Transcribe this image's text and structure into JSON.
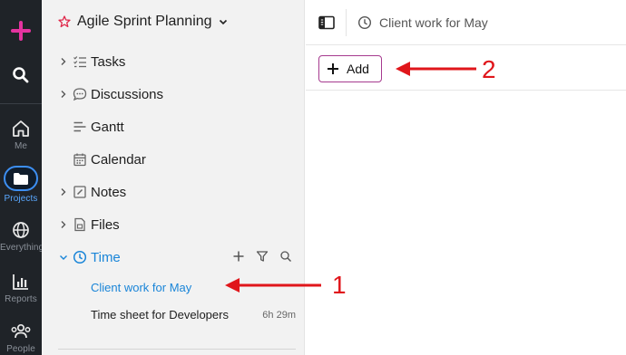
{
  "rail": {
    "items": [
      {
        "label": "Me",
        "icon": "home-icon"
      },
      {
        "label": "Projects",
        "icon": "folder-icon"
      },
      {
        "label": "Everything",
        "icon": "globe-icon"
      },
      {
        "label": "Reports",
        "icon": "bar-chart-icon"
      },
      {
        "label": "People",
        "icon": "people-icon"
      }
    ],
    "accent": "#e4339f",
    "active_color": "#3d8ff2"
  },
  "project": {
    "title": "Agile Sprint Planning"
  },
  "nav": {
    "items": [
      {
        "label": "Tasks",
        "icon": "checklist-icon",
        "expandable": true
      },
      {
        "label": "Discussions",
        "icon": "chat-icon",
        "expandable": true
      },
      {
        "label": "Gantt",
        "icon": "gantt-icon",
        "expandable": false
      },
      {
        "label": "Calendar",
        "icon": "calendar-icon",
        "expandable": false
      },
      {
        "label": "Notes",
        "icon": "note-icon",
        "expandable": true
      },
      {
        "label": "Files",
        "icon": "file-icon",
        "expandable": true
      },
      {
        "label": "Time",
        "icon": "clock-icon",
        "expanded": true
      }
    ],
    "time_children": [
      {
        "label": "Client work for May",
        "meta": "",
        "active": true
      },
      {
        "label": "Time sheet for Developers",
        "meta": "6h 29m",
        "active": false
      }
    ]
  },
  "main": {
    "breadcrumb_title": "Client work for May",
    "add_label": "Add"
  },
  "annotations": {
    "label_1": "1",
    "label_2": "2",
    "color": "#e0161b"
  }
}
